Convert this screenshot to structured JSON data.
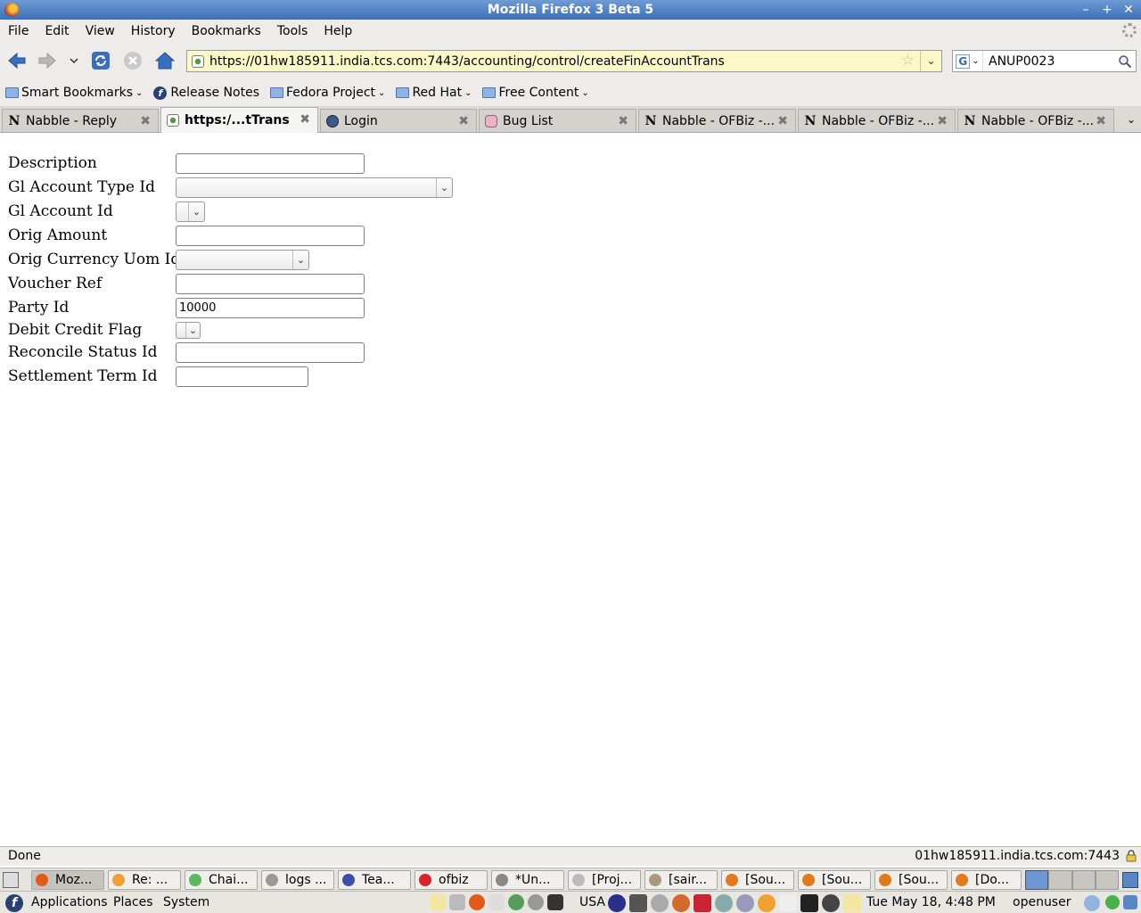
{
  "window": {
    "title": "Mozilla Firefox 3 Beta 5"
  },
  "menubar": [
    "File",
    "Edit",
    "View",
    "History",
    "Bookmarks",
    "Tools",
    "Help"
  ],
  "nav": {
    "url": "https://01hw185911.india.tcs.com:7443/accounting/control/createFinAccountTrans",
    "search_query": "ANUP0023"
  },
  "bookmarks": [
    {
      "label": "Smart Bookmarks",
      "icon": "folder-icon",
      "dropdown": true
    },
    {
      "label": "Release Notes",
      "icon": "fedora-icon",
      "dropdown": false
    },
    {
      "label": "Fedora Project",
      "icon": "folder-icon",
      "dropdown": true
    },
    {
      "label": "Red Hat",
      "icon": "folder-icon",
      "dropdown": true
    },
    {
      "label": "Free Content",
      "icon": "folder-icon",
      "dropdown": true
    }
  ],
  "tabs": [
    {
      "label": "Nabble - Reply",
      "icon": "nabble-icon",
      "active": false
    },
    {
      "label": "https:/...tTrans",
      "icon": "page-icon",
      "active": true
    },
    {
      "label": "Login",
      "icon": "login-icon",
      "active": false
    },
    {
      "label": "Bug List",
      "icon": "bug-icon",
      "active": false
    },
    {
      "label": "Nabble - OFBiz -...",
      "icon": "nabble-icon",
      "active": false
    },
    {
      "label": "Nabble - OFBiz -...",
      "icon": "nabble-icon",
      "active": false
    },
    {
      "label": "Nabble - OFBiz -...",
      "icon": "nabble-icon",
      "active": false
    }
  ],
  "form": {
    "fields": [
      {
        "label": "Description",
        "type": "text",
        "value": ""
      },
      {
        "label": "Gl Account Type Id",
        "type": "select",
        "value": ""
      },
      {
        "label": "Gl Account Id",
        "type": "select",
        "value": ""
      },
      {
        "label": "Orig Amount",
        "type": "text",
        "value": ""
      },
      {
        "label": "Orig Currency Uom Id",
        "type": "select",
        "value": ""
      },
      {
        "label": "Voucher Ref",
        "type": "text",
        "value": ""
      },
      {
        "label": "Party Id",
        "type": "text",
        "value": "10000"
      },
      {
        "label": "Debit Credit Flag",
        "type": "select",
        "value": ""
      },
      {
        "label": "Reconcile Status Id",
        "type": "text",
        "value": ""
      },
      {
        "label": "Settlement Term Id",
        "type": "text",
        "value": ""
      }
    ]
  },
  "status": {
    "left": "Done",
    "right": "01hw185911.india.tcs.com:7443"
  },
  "taskbar": [
    {
      "label": "Moz...",
      "color": "#e2591a",
      "active": true
    },
    {
      "label": "Re: ...",
      "color": "#f0a030",
      "active": false
    },
    {
      "label": "Chai...",
      "color": "#5cb85c",
      "active": false
    },
    {
      "label": "logs ...",
      "color": "#999999",
      "active": false
    },
    {
      "label": "Tea...",
      "color": "#3d4fa8",
      "active": false
    },
    {
      "label": "ofbiz",
      "color": "#d9232d",
      "active": false
    },
    {
      "label": "*Un...",
      "color": "#888888",
      "active": false
    },
    {
      "label": "[Proj...",
      "color": "#bbbbbb",
      "active": false
    },
    {
      "label": "[sair...",
      "color": "#a89a7a",
      "active": false
    },
    {
      "label": "[Sou...",
      "color": "#e2791a",
      "active": false
    },
    {
      "label": "[Sou...",
      "color": "#e2791a",
      "active": false
    },
    {
      "label": "[Sou...",
      "color": "#e2791a",
      "active": false
    },
    {
      "label": "[Do...",
      "color": "#e2791a",
      "active": false
    }
  ],
  "panel": {
    "menus": [
      "Applications",
      "Places",
      "System"
    ],
    "keyboard": "USA",
    "clock": "Tue May 18,  4:48 PM",
    "user": "openuser"
  }
}
